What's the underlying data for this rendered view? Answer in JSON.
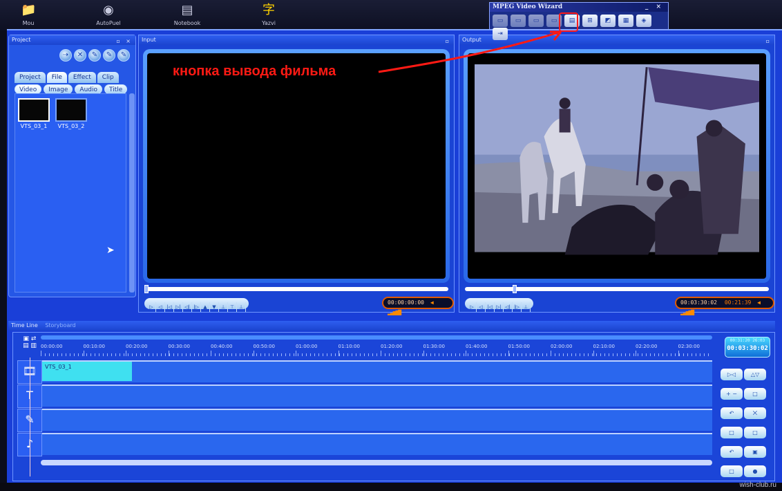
{
  "desktop": {
    "icons": [
      {
        "label": "Mou",
        "icon": "folder-icon"
      },
      {
        "label": "AutoPuel",
        "icon": "globe-icon"
      },
      {
        "label": "Notebook",
        "icon": "notebook-icon"
      },
      {
        "label": "Yazvi",
        "icon": "character-icon"
      }
    ]
  },
  "wizard": {
    "title": "MPEG Video Wizard",
    "controls": "_ ×",
    "buttons": [
      {
        "icon": "new-project-icon",
        "glyph": "▭"
      },
      {
        "icon": "open-icon",
        "glyph": "▭"
      },
      {
        "icon": "save-icon",
        "glyph": "▭"
      },
      {
        "icon": "undo-icon",
        "glyph": "▭"
      },
      {
        "icon": "output-movie-icon",
        "glyph": "▤"
      },
      {
        "icon": "capture-icon",
        "glyph": "⊞"
      },
      {
        "icon": "edit-icon",
        "glyph": "◩"
      },
      {
        "icon": "storyboard-icon",
        "glyph": "▦"
      },
      {
        "icon": "settings-icon",
        "glyph": "◈"
      },
      {
        "icon": "exit-icon",
        "glyph": "⇥"
      }
    ]
  },
  "annotation": {
    "text": "кнопка вывода фильма",
    "color": "#ff1a14"
  },
  "project": {
    "title": "Project",
    "controls": "▫ ×",
    "round_buttons": [
      "⇢",
      "✕",
      "✎",
      "✎",
      "✎"
    ],
    "tabs": [
      "Project",
      "File",
      "Effect",
      "Clip"
    ],
    "active_tab": "File",
    "subtabs": [
      "Video",
      "Image",
      "Audio",
      "Title"
    ],
    "active_subtab": "Video",
    "files": [
      {
        "name": "VTS_03_1",
        "selected": true
      },
      {
        "name": "VTS_03_2",
        "selected": false
      }
    ]
  },
  "input": {
    "title": "Input",
    "controls": "▫",
    "transport": [
      "▷",
      "◁",
      "|◁",
      "▷|",
      "◁|",
      "|▷",
      "▲",
      "▼",
      "⊥",
      "⊤",
      "⊥"
    ],
    "timecode": "00:00:00:00",
    "volume": "◀ ▂▃▅▆▇"
  },
  "output": {
    "title": "Output",
    "controls": "▫",
    "transport": [
      "▷",
      "◁",
      "|◁",
      "▷|",
      "◁|",
      "|▷",
      "⊥"
    ],
    "timecode": "00:03:30:02",
    "timecode2": "00:21:39",
    "volume": "◀ ▂▃▅▆▇",
    "position": 0.16
  },
  "timeline": {
    "title": "Time Line",
    "subtitle": "Storyboard",
    "ruler_labels": [
      "00:00:00",
      "00:10:00",
      "00:20:00",
      "00:30:00",
      "00:40:00",
      "00:50:00",
      "01:00:00",
      "01:10:00",
      "01:20:00",
      "01:30:00",
      "01:40:00",
      "01:50:00",
      "02:00:00",
      "02:10:00",
      "02:20:00",
      "02:30:00"
    ],
    "tracks": [
      {
        "icon": "video-track-icon",
        "glyph": "🎞",
        "clip": "VTS_03_1"
      },
      {
        "icon": "text-track-icon",
        "glyph": "T",
        "clip": ""
      },
      {
        "icon": "effect-track-icon",
        "glyph": "✎",
        "clip": ""
      },
      {
        "icon": "audio-track-icon",
        "glyph": "♪",
        "clip": ""
      }
    ],
    "tc_display_small": "00:31:20  26:03",
    "tc_display": "00:03:30:02",
    "side_buttons": [
      "▷◁",
      "△▽",
      "+ −",
      "□",
      "↶",
      "⨉",
      "□",
      "□",
      "↶",
      "▣",
      "□",
      "●"
    ]
  },
  "watermark": "wish-club.ru"
}
